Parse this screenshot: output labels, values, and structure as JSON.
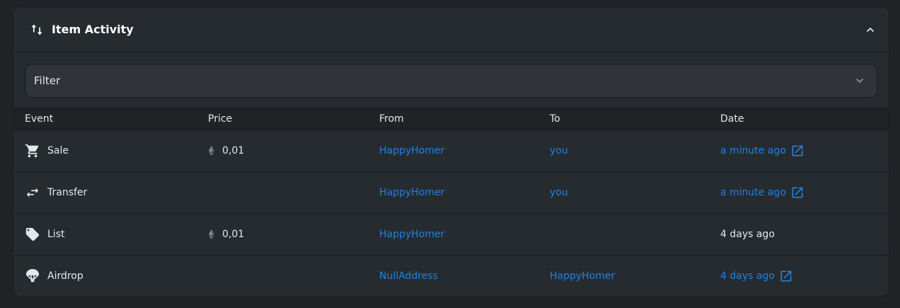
{
  "header": {
    "title": "Item Activity",
    "title_icon": "swap-vertical-icon",
    "collapse_icon": "chevron-up-icon"
  },
  "filter": {
    "label": "Filter",
    "icon": "chevron-down-icon"
  },
  "columns": [
    "Event",
    "Price",
    "From",
    "To",
    "Date"
  ],
  "rows": [
    {
      "event": "Sale",
      "event_icon": "cart-icon",
      "price": "0,01",
      "price_icon": "eth-icon",
      "from": "HappyHomer",
      "to": "you",
      "date": "a minute ago",
      "date_linked": true
    },
    {
      "event": "Transfer",
      "event_icon": "transfer-icon",
      "price": "",
      "price_icon": "",
      "from": "HappyHomer",
      "to": "you",
      "date": "a minute ago",
      "date_linked": true
    },
    {
      "event": "List",
      "event_icon": "tag-icon",
      "price": "0,01",
      "price_icon": "eth-icon",
      "from": "HappyHomer",
      "to": "",
      "date": "4 days ago",
      "date_linked": false
    },
    {
      "event": "Airdrop",
      "event_icon": "parachute-icon",
      "price": "",
      "price_icon": "",
      "from": "NullAddress",
      "to": "HappyHomer",
      "date": "4 days ago",
      "date_linked": true
    }
  ],
  "colors": {
    "background": "#202225",
    "panel": "#262b2f",
    "border": "#151b22",
    "link": "#2081e2",
    "text": "#e5e8eb"
  }
}
